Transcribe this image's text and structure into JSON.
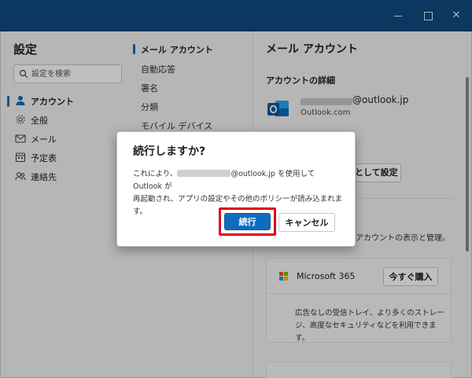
{
  "window": {
    "minimize_icon": "minimize-icon",
    "maximize_icon": "maximize-icon",
    "close_icon": "close-icon",
    "close_glyph": "✕"
  },
  "settings": {
    "title": "設定",
    "search_placeholder": "設定を検索",
    "nav": [
      {
        "label": "アカウント",
        "icon": "person-icon",
        "active": true
      },
      {
        "label": "全般",
        "icon": "gear-icon"
      },
      {
        "label": "メール",
        "icon": "mail-icon"
      },
      {
        "label": "予定表",
        "icon": "calendar-icon"
      },
      {
        "label": "連絡先",
        "icon": "people-icon"
      }
    ],
    "subnav": [
      "メール アカウント",
      "自動応答",
      "署名",
      "分類",
      "モバイル デバイス"
    ]
  },
  "account_pane": {
    "title": "メール アカウント",
    "section_title": "アカウントの詳細",
    "email_suffix": "@outlook.jp",
    "account_type": "Outlook.com",
    "default_button": "既定として設定",
    "manage_text": "アカウントの表示と管理。",
    "m365": {
      "name": "Microsoft 365",
      "buy_button": "今すぐ購入",
      "desc_line1": "広告なしの受信トレイ、より多くのストレー",
      "desc_line2": "ジ、高度なセキュリティなどを利用できます。"
    }
  },
  "dialog": {
    "title": "続行しますか?",
    "body_pre": "これにより、",
    "body_email": "@outlook.jp",
    "body_mid": " を使用して Outlook が",
    "body_line2": "再起動され、アプリの設定やその他のポリシーが読み込まれます。",
    "continue_button": "続行",
    "cancel_button": "キャンセル"
  },
  "colors": {
    "titlebar": "#0f4a82",
    "accent": "#0f6cbd",
    "highlight": "#e0001a"
  }
}
